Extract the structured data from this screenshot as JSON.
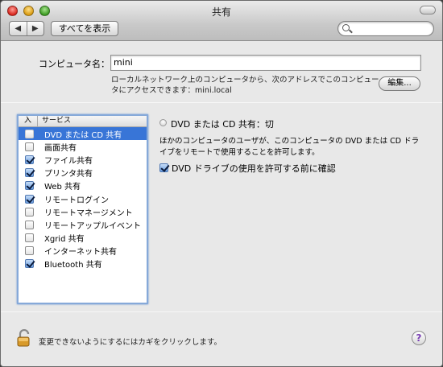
{
  "window": {
    "title": "共有"
  },
  "toolbar": {
    "back_icon": "◀",
    "forward_icon": "▶",
    "show_all_label": "すべてを表示",
    "search_placeholder": ""
  },
  "computer_name": {
    "label": "コンピュータ名：",
    "value": "mini",
    "address_text": "ローカルネットワーク上のコンピュータから、次のアドレスでこのコンピュータにアクセスできます：mini.local",
    "edit_label": "編集..."
  },
  "services": {
    "header_on": "入",
    "header_service": "サービス",
    "items": [
      {
        "label": "DVD または CD 共有",
        "checked": false,
        "selected": true
      },
      {
        "label": "画面共有",
        "checked": false,
        "selected": false
      },
      {
        "label": "ファイル共有",
        "checked": true,
        "selected": false
      },
      {
        "label": "プリンタ共有",
        "checked": true,
        "selected": false
      },
      {
        "label": "Web 共有",
        "checked": true,
        "selected": false
      },
      {
        "label": "リモートログイン",
        "checked": true,
        "selected": false
      },
      {
        "label": "リモートマネージメント",
        "checked": false,
        "selected": false
      },
      {
        "label": "リモートアップルイベント",
        "checked": false,
        "selected": false
      },
      {
        "label": "Xgrid 共有",
        "checked": false,
        "selected": false
      },
      {
        "label": "インターネット共有",
        "checked": false,
        "selected": false
      },
      {
        "label": "Bluetooth 共有",
        "checked": true,
        "selected": false
      }
    ]
  },
  "detail": {
    "status_text": "DVD または CD 共有：切",
    "description": "ほかのコンピュータのユーザが、このコンピュータの DVD または CD ドライブをリモートで使用することを許可します。",
    "ask_label": "DVD ドライブの使用を許可する前に確認",
    "ask_checked": true
  },
  "footer": {
    "lock_text": "変更できないようにするにはカギをクリックします。",
    "help_label": "?"
  }
}
